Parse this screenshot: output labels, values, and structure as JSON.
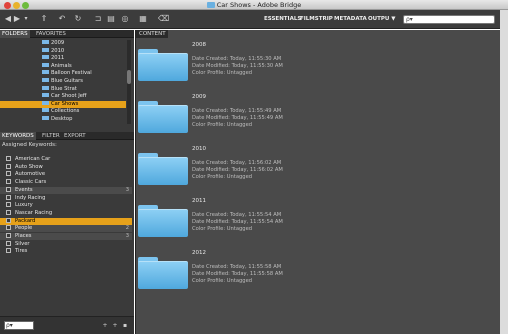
{
  "window": {
    "title": "Car Shows - Adobe Bridge"
  },
  "toolbar": {
    "workspaces": [
      "ESSENTIALS",
      "FILMSTRIP",
      "METADATA",
      "OUTPU ▼"
    ],
    "search_value": "ρ▾"
  },
  "left_panel": {
    "tabs": [
      "FOLDERS",
      "FAVORITES"
    ],
    "tree": [
      {
        "label": "2009",
        "selected": false
      },
      {
        "label": "2010",
        "selected": false
      },
      {
        "label": "2011",
        "selected": false
      },
      {
        "label": "Animals",
        "selected": false
      },
      {
        "label": "Balloon Festival",
        "selected": false
      },
      {
        "label": "Blue Guitars",
        "selected": false
      },
      {
        "label": "Blue Strat",
        "selected": false
      },
      {
        "label": "Car Shoot Jeff",
        "selected": false
      },
      {
        "label": "Car Shows",
        "selected": true
      },
      {
        "label": "Collections",
        "selected": false
      },
      {
        "label": "Desktop",
        "selected": false
      }
    ],
    "bottom_tabs": [
      "KEYWORDS",
      "FILTER",
      "EXPORT"
    ],
    "assigned_label": "Assigned Keywords:",
    "keywords": [
      {
        "label": "American Car",
        "type": "item"
      },
      {
        "label": "Auto Show",
        "type": "item"
      },
      {
        "label": "Automotive",
        "type": "item"
      },
      {
        "label": "Classic Cars",
        "type": "item"
      },
      {
        "label": "Events",
        "type": "cat",
        "count": "3"
      },
      {
        "label": "Indy Racing",
        "type": "item"
      },
      {
        "label": "Luxury",
        "type": "item"
      },
      {
        "label": "Nascar Racing",
        "type": "item"
      },
      {
        "label": "Packard",
        "type": "sel"
      },
      {
        "label": "People",
        "type": "cat",
        "count": "2"
      },
      {
        "label": "Places",
        "type": "cat",
        "count": "3"
      },
      {
        "label": "Silver",
        "type": "item"
      },
      {
        "label": "Tires",
        "type": "item"
      }
    ],
    "keyword_search": "ρ▾"
  },
  "content": {
    "tab": "CONTENT",
    "items": [
      {
        "name": "2008",
        "created": "Date Created: Today, 11:55:30 AM",
        "modified": "Date Modified: Today, 11:55:30 AM",
        "profile": "Color Profile: Untagged"
      },
      {
        "name": "2009",
        "created": "Date Created: Today, 11:55:49 AM",
        "modified": "Date Modified: Today, 11:55:49 AM",
        "profile": "Color Profile: Untagged"
      },
      {
        "name": "2010",
        "created": "Date Created: Today, 11:56:02 AM",
        "modified": "Date Modified: Today, 11:56:02 AM",
        "profile": "Color Profile: Untagged"
      },
      {
        "name": "2011",
        "created": "Date Created: Today, 11:55:54 AM",
        "modified": "Date Modified: Today, 11:55:54 AM",
        "profile": "Color Profile: Untagged"
      },
      {
        "name": "2012",
        "created": "Date Created: Today, 11:55:58 AM",
        "modified": "Date Modified: Today, 11:55:58 AM",
        "profile": "Color Profile: Untagged"
      }
    ]
  },
  "colors": {
    "accent": "#e6a11a",
    "folder": "#6ab8e8"
  }
}
